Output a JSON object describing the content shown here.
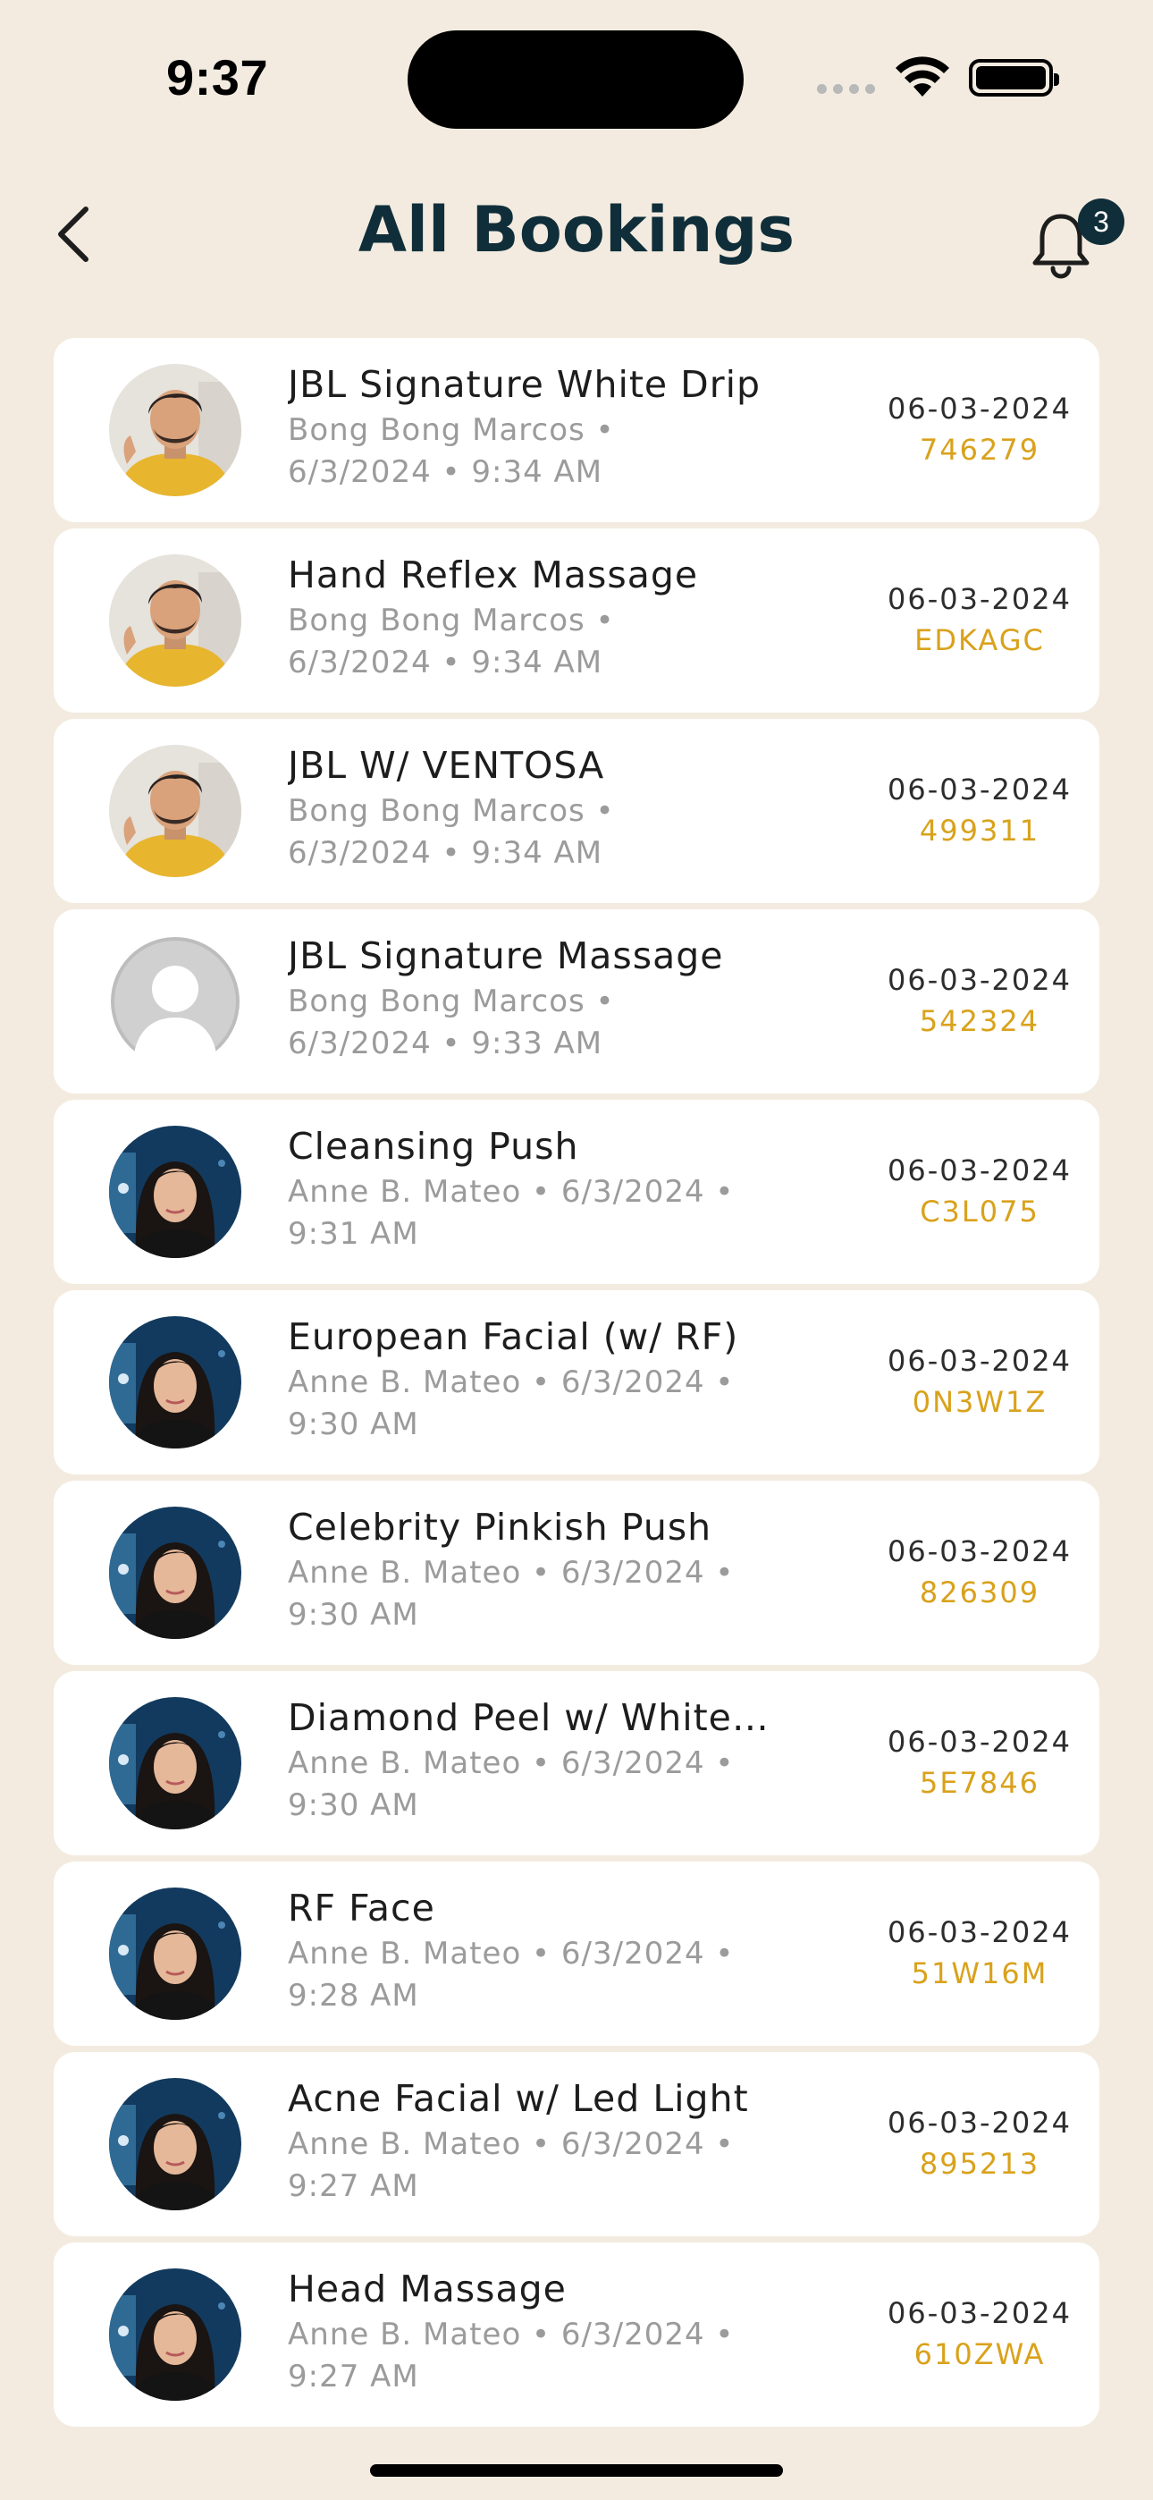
{
  "status_bar": {
    "time": "9:37"
  },
  "header": {
    "title": "All Bookings",
    "notification_count": "3"
  },
  "bookings": [
    {
      "service": "JBL Signature White Drip",
      "meta_line1": "Bong Bong Marcos •",
      "meta_line2": "6/3/2024 • 9:34 AM",
      "date": "06-03-2024",
      "code": "746279",
      "avatar": "man-photo"
    },
    {
      "service": "Hand Reflex Massage",
      "meta_line1": "Bong Bong Marcos •",
      "meta_line2": "6/3/2024 • 9:34 AM",
      "date": "06-03-2024",
      "code": "EDKAGC",
      "avatar": "man-photo"
    },
    {
      "service": "JBL W/ VENTOSA",
      "meta_line1": "Bong Bong Marcos •",
      "meta_line2": "6/3/2024 • 9:34 AM",
      "date": "06-03-2024",
      "code": "499311",
      "avatar": "man-photo"
    },
    {
      "service": "JBL Signature Massage",
      "meta_line1": "Bong Bong Marcos •",
      "meta_line2": "6/3/2024 • 9:33 AM",
      "date": "06-03-2024",
      "code": "542324",
      "avatar": "placeholder"
    },
    {
      "service": "Cleansing Push",
      "meta_line1": "Anne B. Mateo • 6/3/2024 •",
      "meta_line2": "9:31 AM",
      "date": "06-03-2024",
      "code": "C3L075",
      "avatar": "woman-photo"
    },
    {
      "service": "European Facial (w/ RF)",
      "meta_line1": "Anne B. Mateo • 6/3/2024 •",
      "meta_line2": "9:30 AM",
      "date": "06-03-2024",
      "code": "0N3W1Z",
      "avatar": "woman-photo"
    },
    {
      "service": "Celebrity Pinkish Push",
      "meta_line1": "Anne B. Mateo • 6/3/2024 •",
      "meta_line2": "9:30 AM",
      "date": "06-03-2024",
      "code": "826309",
      "avatar": "woman-photo"
    },
    {
      "service": "Diamond Peel w/ White…",
      "meta_line1": "Anne B. Mateo • 6/3/2024 •",
      "meta_line2": "9:30 AM",
      "date": "06-03-2024",
      "code": "5E7846",
      "avatar": "woman-photo"
    },
    {
      "service": "RF Face",
      "meta_line1": "Anne B. Mateo • 6/3/2024 •",
      "meta_line2": "9:28 AM",
      "date": "06-03-2024",
      "code": "51W16M",
      "avatar": "woman-photo"
    },
    {
      "service": "Acne Facial w/ Led Light",
      "meta_line1": "Anne B. Mateo • 6/3/2024 •",
      "meta_line2": "9:27 AM",
      "date": "06-03-2024",
      "code": "895213",
      "avatar": "woman-photo"
    },
    {
      "service": "Head Massage",
      "meta_line1": "Anne B. Mateo • 6/3/2024 •",
      "meta_line2": "9:27 AM",
      "date": "06-03-2024",
      "code": "610ZWA",
      "avatar": "woman-photo"
    }
  ],
  "colors": {
    "background": "#f3ebdf",
    "title": "#0f2e3a",
    "code": "#d9a21c",
    "meta": "#9b9b9b"
  },
  "icons": {
    "back": "chevron-left-icon",
    "notifications": "bell-icon"
  }
}
